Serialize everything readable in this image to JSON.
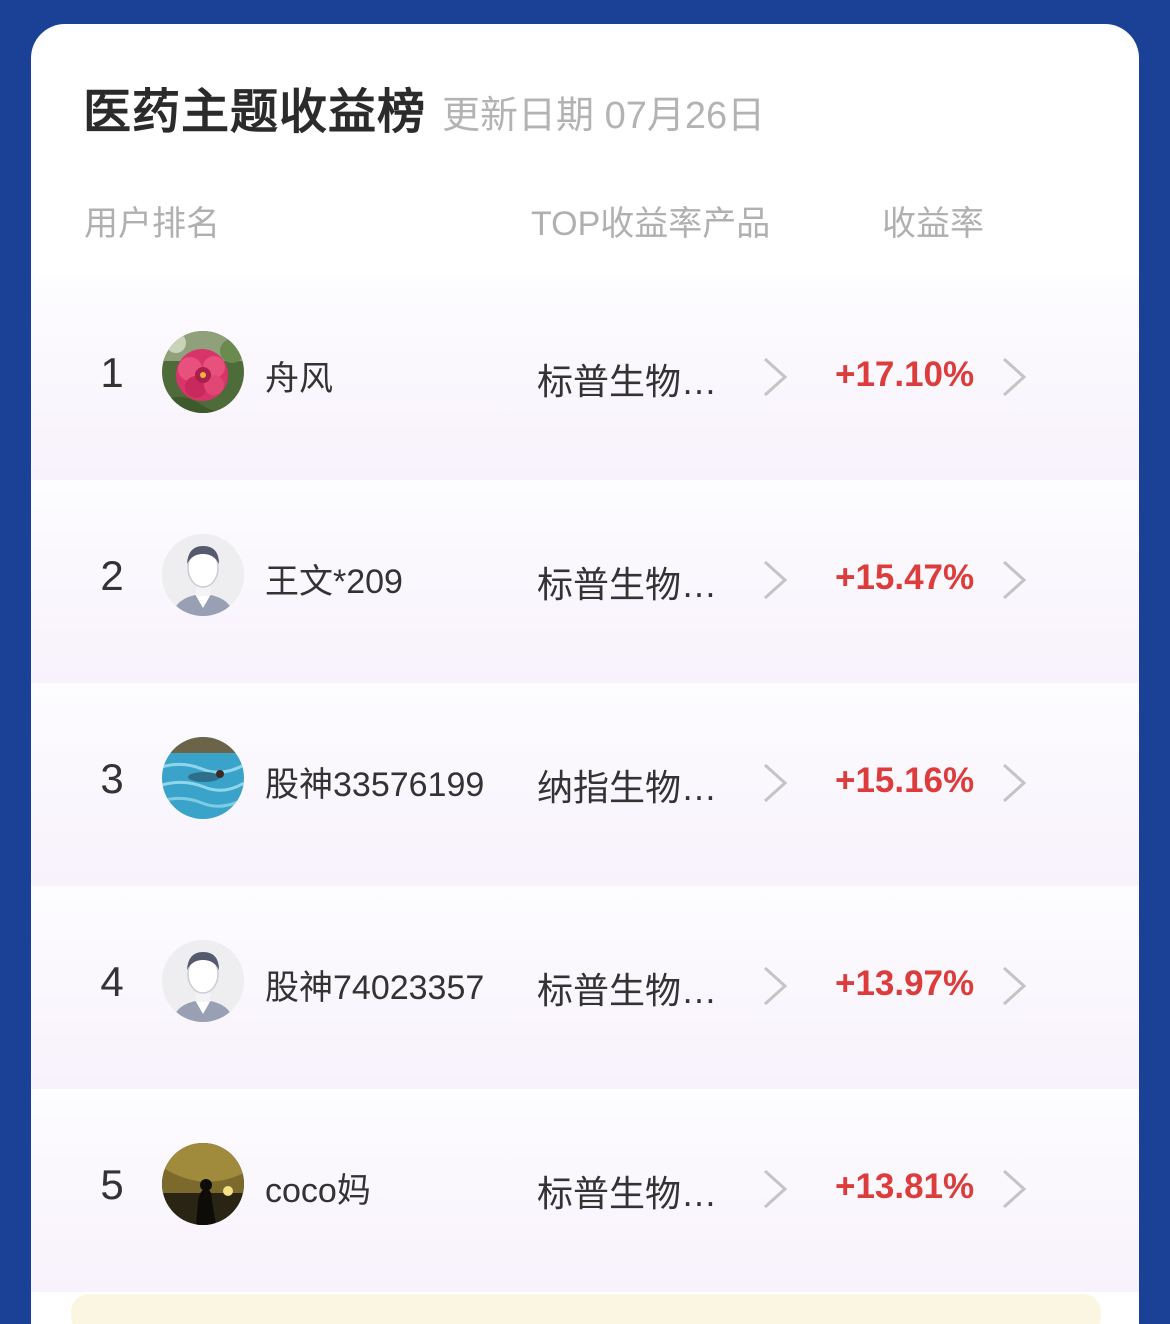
{
  "header": {
    "title": "医药主题收益榜",
    "update_label": "更新日期 07月26日"
  },
  "columns": {
    "user_rank": "用户排名",
    "top_product": "TOP收益率产品",
    "yield": "收益率"
  },
  "rows": [
    {
      "rank": "1",
      "avatar": "flower-avatar",
      "name": "舟风",
      "product": "标普生物…",
      "yield": "+17.10%"
    },
    {
      "rank": "2",
      "avatar": "default-person-avatar",
      "name": "王文*209",
      "product": "标普生物…",
      "yield": "+15.47%"
    },
    {
      "rank": "3",
      "avatar": "swimming-pool-avatar",
      "name": "股神33576199",
      "product": "纳指生物…",
      "yield": "+15.16%"
    },
    {
      "rank": "4",
      "avatar": "default-person-avatar",
      "name": "股神74023357",
      "product": "标普生物…",
      "yield": "+13.97%"
    },
    {
      "rank": "5",
      "avatar": "night-silhouette-avatar",
      "name": "coco妈",
      "product": "标普生物…",
      "yield": "+13.81%"
    }
  ],
  "colors": {
    "background": "#1a4196",
    "positive_yield": "#dc3c3c",
    "muted_text": "#b0b0b0",
    "row_tint": "#f8f2fc"
  }
}
